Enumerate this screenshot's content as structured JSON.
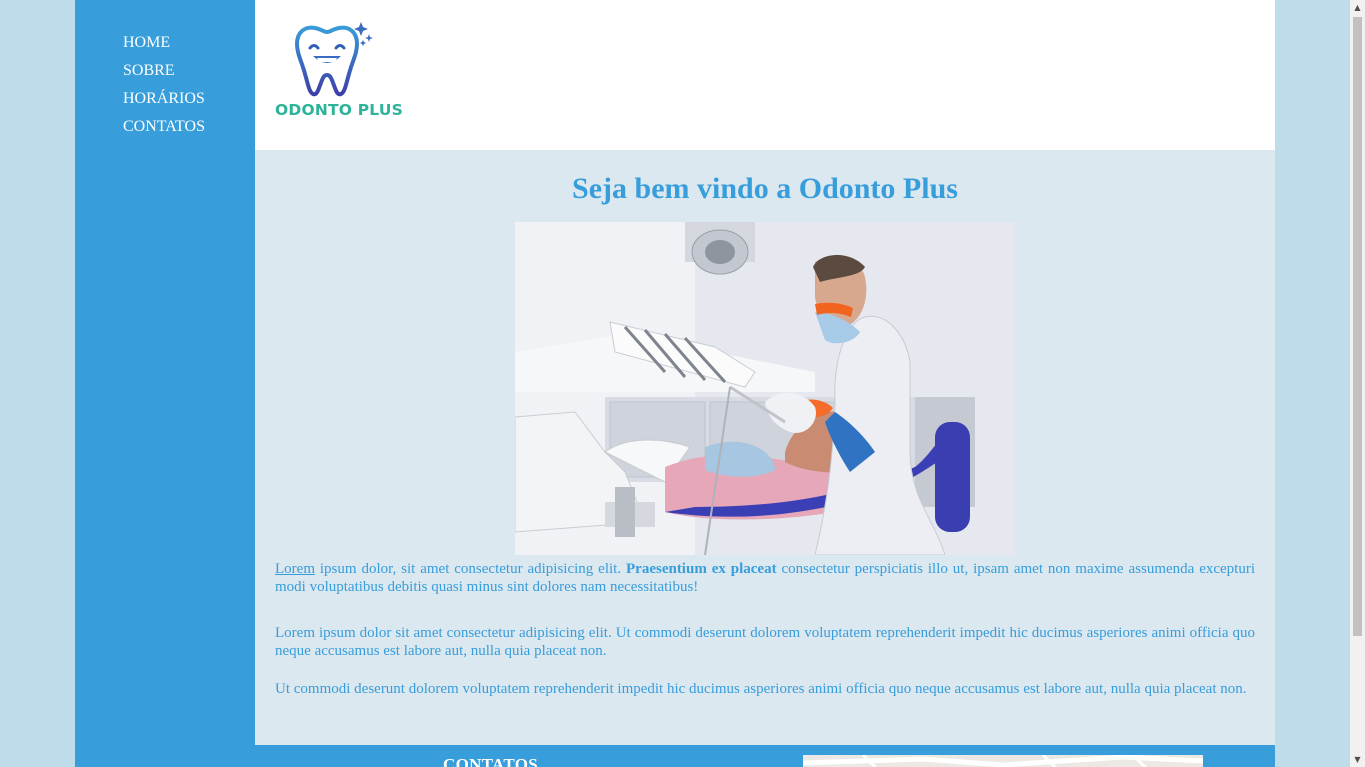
{
  "nav": {
    "items": [
      {
        "label": "HOME"
      },
      {
        "label": "SOBRE"
      },
      {
        "label": "HORÁRIOS"
      },
      {
        "label": "CONTATOS"
      }
    ]
  },
  "header": {
    "logo_text": "ODONTO PLUS",
    "logo_icon": "smiling-tooth-icon"
  },
  "main": {
    "title": "Seja bem vindo a Odonto Plus",
    "photo": "dentist-treating-patient-photo",
    "paragraph1": {
      "link": "Lorem",
      "part1": " ipsum dolor, sit amet consectetur adipisicing elit. ",
      "bold": "Praesentium ex placeat",
      "part2": " consectetur perspiciatis illo ut, ipsam amet non maxime assumenda excepturi modi voluptatibus debitis quasi minus sint dolores nam necessitatibus!"
    },
    "paragraph2": "Lorem ipsum dolor sit amet consectetur adipisicing elit. Ut commodi deserunt dolorem voluptatem reprehenderit impedit hic ducimus asperiores animi officia quo neque accusamus est labore aut, nulla quia placeat non.",
    "paragraph3": "Ut commodi deserunt dolorem voluptatem reprehenderit impedit hic ducimus asperiores animi officia quo neque accusamus est labore aut, nulla quia placeat non."
  },
  "footer": {
    "title": "CONTATOS",
    "map": "map-embed"
  },
  "colors": {
    "brand_blue": "#379ddb",
    "logo_green": "#2db39a",
    "page_bg": "#bfdcea",
    "content_bg": "#dce8f0"
  }
}
